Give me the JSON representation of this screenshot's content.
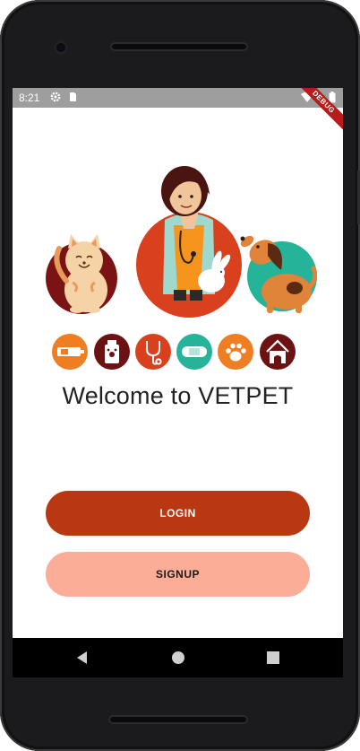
{
  "status_bar": {
    "time": "8:21",
    "left_icons": [
      "settings-icon",
      "sim-card-icon"
    ],
    "right_icons": [
      "wifi-icon",
      "battery-icon"
    ],
    "debug_banner": "DEBUG"
  },
  "hero": {
    "illustration": "vet-with-cat-rabbit-dog",
    "colors": {
      "circle_left": "#7a1414",
      "circle_center": "#d9401e",
      "circle_right": "#25b39a"
    }
  },
  "service_icons": [
    {
      "name": "syringe-icon",
      "bg": "#ef7d22"
    },
    {
      "name": "medicine-bottle-icon",
      "bg": "#6d1212"
    },
    {
      "name": "stethoscope-icon",
      "bg": "#d9401e"
    },
    {
      "name": "bandage-icon",
      "bg": "#25b39a"
    },
    {
      "name": "paw-icon",
      "bg": "#ef7d22"
    },
    {
      "name": "pet-house-icon",
      "bg": "#6d1212"
    }
  ],
  "main": {
    "welcome_text": "Welcome to VETPET",
    "login_label": "LOGIN",
    "signup_label": "SIGNUP"
  },
  "colors": {
    "primary": "#b93812",
    "secondary": "#fcad97"
  },
  "navbar": {
    "icons": [
      "back-icon",
      "home-icon",
      "recents-icon"
    ]
  }
}
